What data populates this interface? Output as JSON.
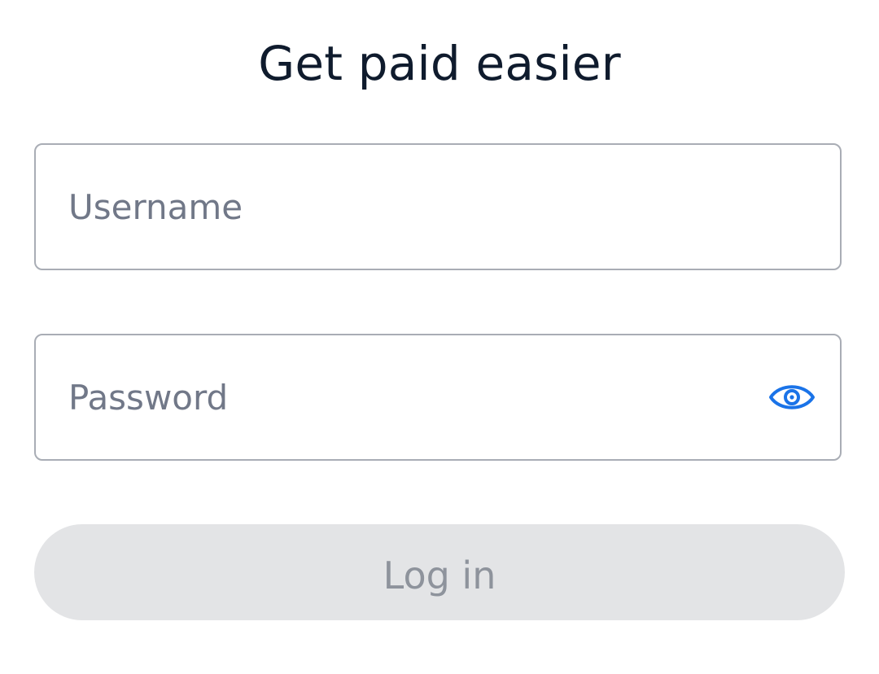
{
  "header": {
    "title": "Get paid easier"
  },
  "form": {
    "username": {
      "placeholder": "Username",
      "value": ""
    },
    "password": {
      "placeholder": "Password",
      "value": "",
      "toggle_icon": "eye-icon"
    },
    "login_label": "Log in"
  },
  "colors": {
    "title_text": "#0f1b2d",
    "placeholder_text": "#717888",
    "field_border": "#a9adb5",
    "accent_icon": "#1a73e8",
    "button_disabled_bg": "#e3e4e6",
    "button_disabled_text": "#8e939c"
  }
}
